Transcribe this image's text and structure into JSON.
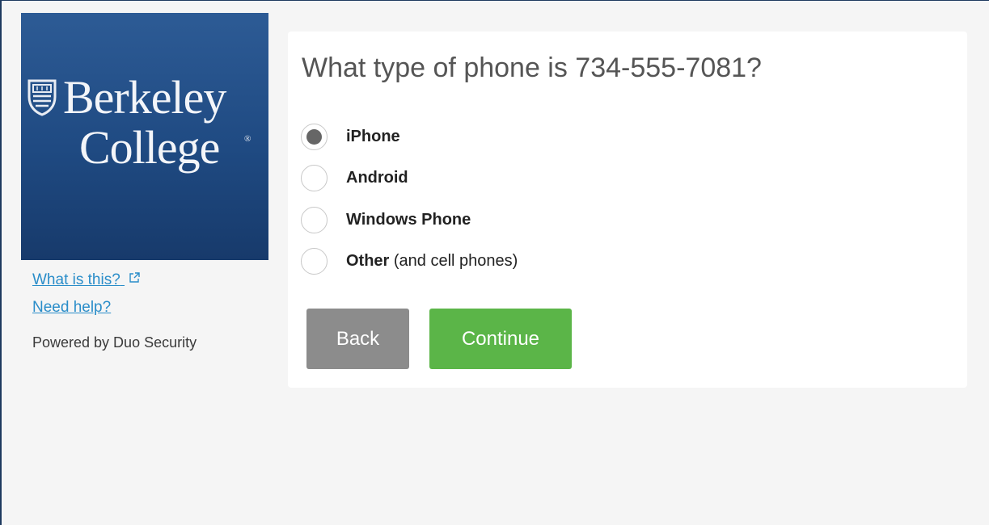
{
  "logo": {
    "line1": "Berkeley",
    "line2": "College",
    "reg_mark": "®",
    "background_color": "#1f4a82"
  },
  "sidebar": {
    "what_is_this": "What is this?",
    "external_icon": "external-link-icon",
    "need_help": "Need help?",
    "powered_by": "Powered by Duo Security"
  },
  "prompt": {
    "title": "What type of phone is 734-555-7081?",
    "options": [
      {
        "label": "iPhone",
        "suffix": "",
        "checked": true
      },
      {
        "label": "Android",
        "suffix": "",
        "checked": false
      },
      {
        "label": "Windows Phone",
        "suffix": "",
        "checked": false
      },
      {
        "label": "Other",
        "suffix": " (and cell phones)",
        "checked": false
      }
    ],
    "back_label": "Back",
    "continue_label": "Continue"
  },
  "colors": {
    "continue": "#5bb548",
    "back": "#8c8c8c",
    "link": "#2a8dc9"
  }
}
